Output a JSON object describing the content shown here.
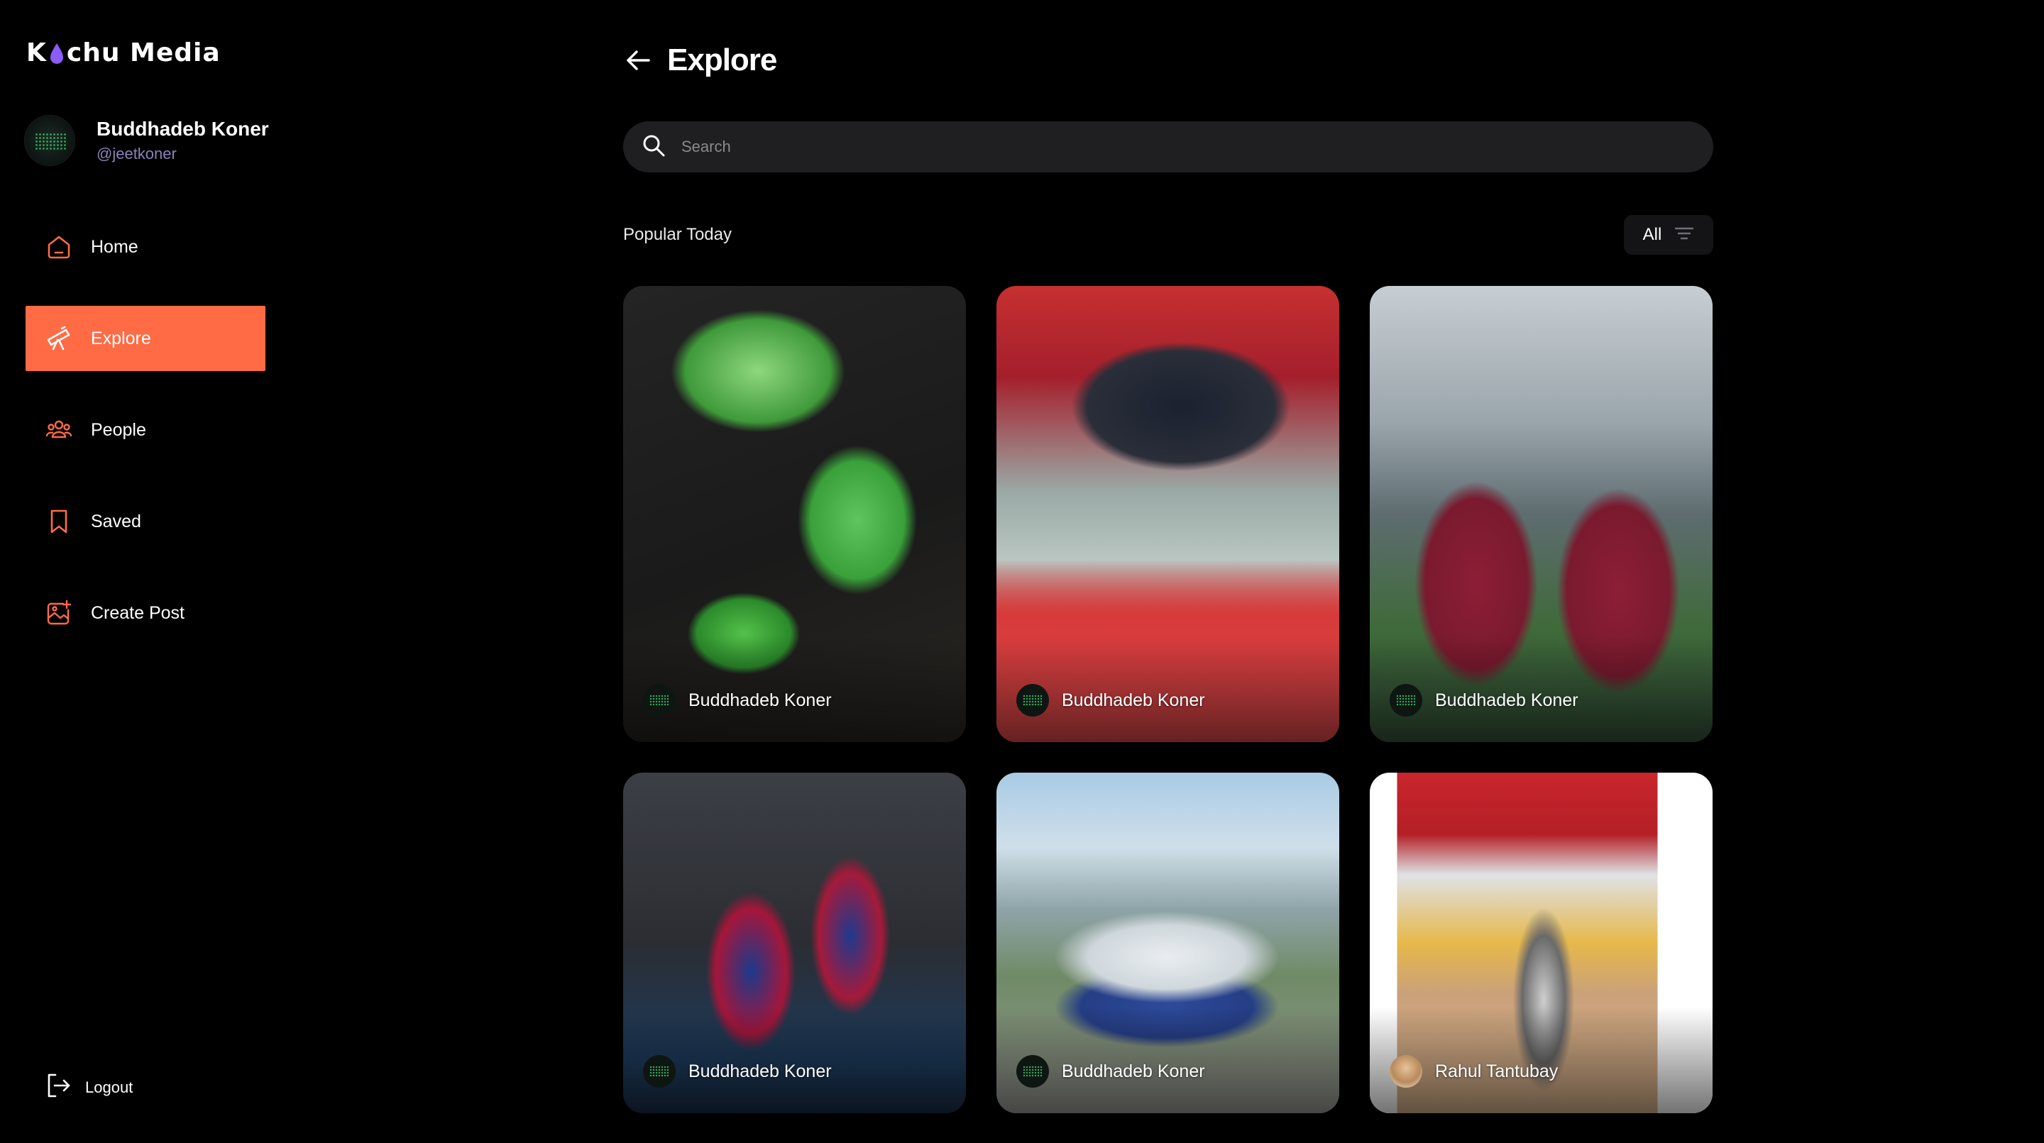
{
  "app": {
    "brand": {
      "prefix": "K",
      "suffix": "chu Media",
      "drop_color": "#8b5cf6"
    },
    "accent": "#ff6b45"
  },
  "profile": {
    "name": "Buddhadeb Koner",
    "handle": "@jeetkoner"
  },
  "sidebar": {
    "items": [
      {
        "label": "Home",
        "icon": "home-icon",
        "active": false
      },
      {
        "label": "Explore",
        "icon": "telescope-icon",
        "active": true
      },
      {
        "label": "People",
        "icon": "people-icon",
        "active": false
      },
      {
        "label": "Saved",
        "icon": "bookmark-icon",
        "active": false
      },
      {
        "label": "Create Post",
        "icon": "add-image-icon",
        "active": false
      }
    ],
    "logout": "Logout"
  },
  "header": {
    "title": "Explore"
  },
  "search": {
    "placeholder": "Search",
    "value": ""
  },
  "section": {
    "title": "Popular Today",
    "filter": "All"
  },
  "posts": [
    {
      "author": "Buddhadeb Koner"
    },
    {
      "author": "Buddhadeb Koner"
    },
    {
      "author": "Buddhadeb Koner"
    },
    {
      "author": "Buddhadeb Koner"
    },
    {
      "author": "Buddhadeb Koner"
    },
    {
      "author": "Rahul Tantubay"
    }
  ]
}
